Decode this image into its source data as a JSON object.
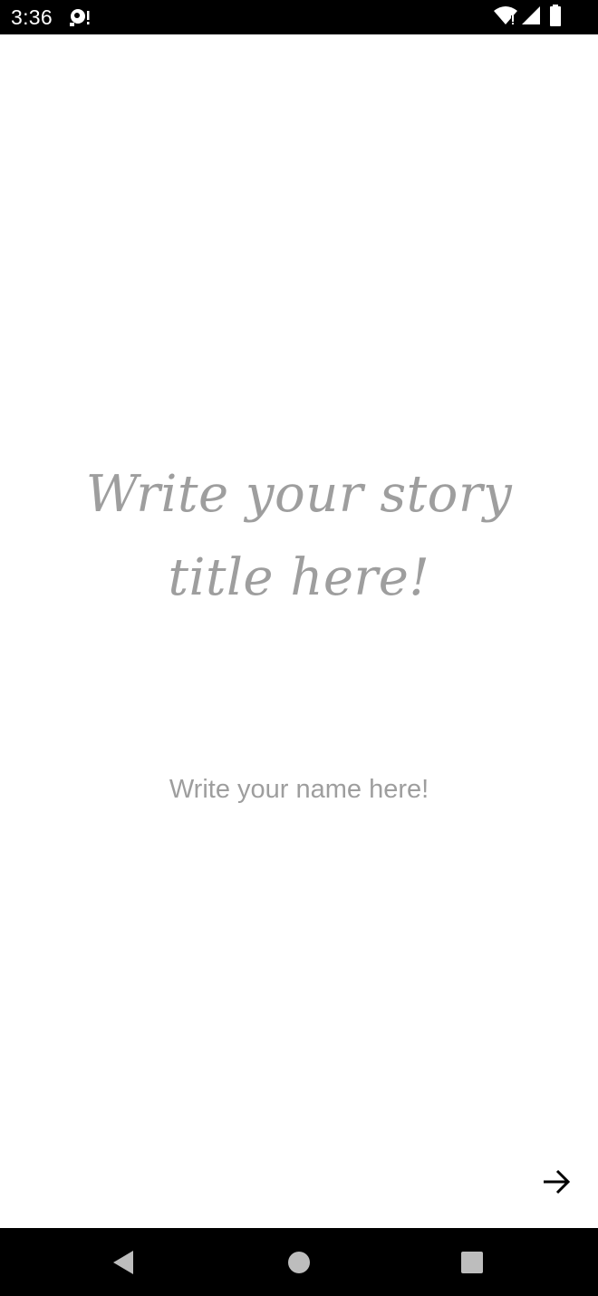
{
  "status_bar": {
    "time": "3:36",
    "icons": [
      "notification-icon",
      "wifi-icon",
      "signal-icon",
      "battery-icon"
    ]
  },
  "story": {
    "title_placeholder": "Write your story title here!",
    "author_placeholder": "Write your name here!"
  },
  "actions": {
    "next_icon": "arrow-right-icon"
  },
  "navigation": {
    "icons": [
      "back-icon",
      "home-icon",
      "recents-icon"
    ]
  },
  "colors": {
    "placeholder": "#9e9e9e",
    "bars": "#000000",
    "nav_icons": "#bdbdbd"
  }
}
